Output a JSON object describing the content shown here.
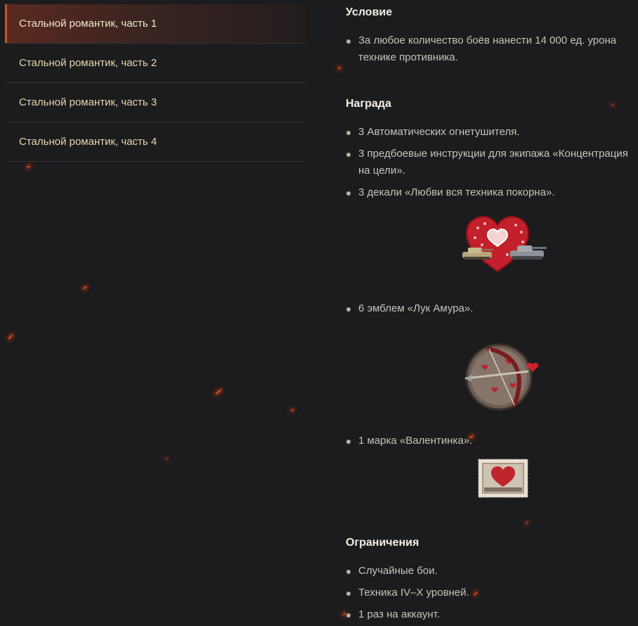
{
  "sidebar": {
    "items": [
      {
        "label": "Стальной романтик, часть 1",
        "active": true
      },
      {
        "label": "Стальной романтик, часть 2",
        "active": false
      },
      {
        "label": "Стальной романтик, часть 3",
        "active": false
      },
      {
        "label": "Стальной романтик, часть 4",
        "active": false
      }
    ]
  },
  "condition": {
    "title": "Условие",
    "items": [
      "За любое количество боёв нанести 14 000 ед. урона технике противника."
    ]
  },
  "reward": {
    "title": "Награда",
    "items": [
      "3 Автоматических огнетушителя.",
      "3 предбоевые инструкции для экипажа «Концентрация на цели».",
      "3 декали «Любви вся техника покорна».",
      "6 эмблем «Лук Амура».",
      "1 марка «Валентинка»."
    ],
    "images": [
      "heart-tanks-decal-icon",
      "cupid-bow-emblem-icon",
      "valentine-stamp-icon"
    ]
  },
  "restrictions": {
    "title": "Ограничения",
    "items": [
      "Случайные бои.",
      "Техника IV–X уровней.",
      "1 раз на аккаунт."
    ]
  },
  "colors": {
    "background": "#1c1c1e",
    "sidebar_text": "#e6d7ac",
    "active_accent": "#c4582a",
    "heading": "#f3efe6",
    "body_text": "#c8c3ba"
  }
}
